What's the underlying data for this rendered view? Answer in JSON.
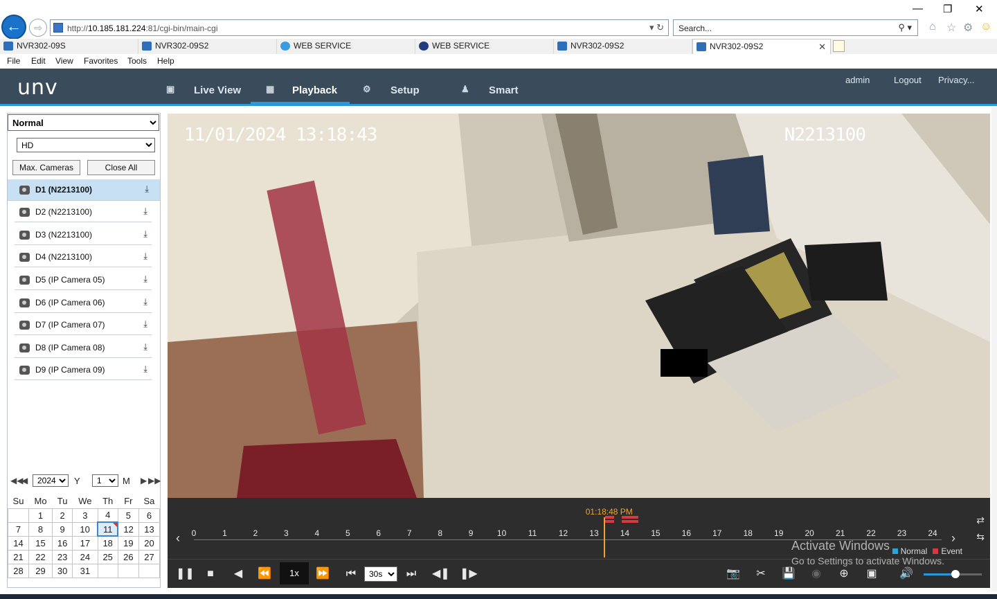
{
  "browser": {
    "url_prefix": "http://",
    "url_host": "10.185.181.224",
    "url_path": ":81/cgi-bin/main-cgi",
    "search_placeholder": "Search...",
    "tabs": [
      {
        "label": "NVR302-09S"
      },
      {
        "label": "NVR302-09S2"
      },
      {
        "label": "WEB SERVICE"
      },
      {
        "label": "WEB SERVICE"
      },
      {
        "label": "NVR302-09S2"
      },
      {
        "label": "NVR302-09S2"
      }
    ],
    "menu": [
      "File",
      "Edit",
      "View",
      "Favorites",
      "Tools",
      "Help"
    ]
  },
  "app": {
    "logo": "unv",
    "nav": [
      {
        "label": "Live View"
      },
      {
        "label": "Playback"
      },
      {
        "label": "Setup"
      },
      {
        "label": "Smart"
      }
    ],
    "user": "admin",
    "logout": "Logout",
    "privacy": "Privacy..."
  },
  "sidebar": {
    "mode": "Normal",
    "stream": "HD",
    "max_cameras": "Max. Cameras",
    "close_all": "Close All",
    "cameras": [
      {
        "label": "D1 (N2213100)"
      },
      {
        "label": "D2 (N2213100)"
      },
      {
        "label": "D3 (N2213100)"
      },
      {
        "label": "D4 (N2213100)"
      },
      {
        "label": "D5 (IP Camera 05)"
      },
      {
        "label": "D6 (IP Camera 06)"
      },
      {
        "label": "D7 (IP Camera 07)"
      },
      {
        "label": "D8 (IP Camera 08)"
      },
      {
        "label": "D9 (IP Camera 09)"
      }
    ],
    "calendar": {
      "year": "2024",
      "year_label": "Y",
      "month": "1",
      "month_label": "M",
      "weekdays": [
        "Su",
        "Mo",
        "Tu",
        "We",
        "Th",
        "Fr",
        "Sa"
      ],
      "weeks": [
        [
          "",
          "1",
          "2",
          "3",
          "4",
          "5",
          "6"
        ],
        [
          "7",
          "8",
          "9",
          "10",
          "11",
          "12",
          "13"
        ],
        [
          "14",
          "15",
          "16",
          "17",
          "18",
          "19",
          "20"
        ],
        [
          "21",
          "22",
          "23",
          "24",
          "25",
          "26",
          "27"
        ],
        [
          "28",
          "29",
          "30",
          "31",
          "",
          "",
          ""
        ]
      ],
      "selected_day": "11"
    }
  },
  "video": {
    "osd_datetime": "11/01/2024 13:18:43",
    "osd_name": "N2213100"
  },
  "timeline": {
    "current_time": "01:18:48 PM",
    "cursor_hour": 13.31,
    "hours": [
      "0",
      "1",
      "2",
      "3",
      "4",
      "5",
      "6",
      "7",
      "8",
      "9",
      "10",
      "11",
      "12",
      "13",
      "14",
      "15",
      "16",
      "17",
      "18",
      "19",
      "20",
      "21",
      "22",
      "23",
      "24"
    ],
    "events": [
      [
        13.35,
        13.65
      ],
      [
        13.9,
        14.45
      ]
    ],
    "legend_normal": "Normal",
    "legend_event": "Event",
    "normal_color": "#2aa5d8",
    "event_color": "#d9383c"
  },
  "controls": {
    "speed": "1x",
    "interval": "30s",
    "volume_fraction": 0.55
  },
  "watermark": {
    "line1": "Activate Windows",
    "line2": "Go to Settings to activate Windows."
  }
}
